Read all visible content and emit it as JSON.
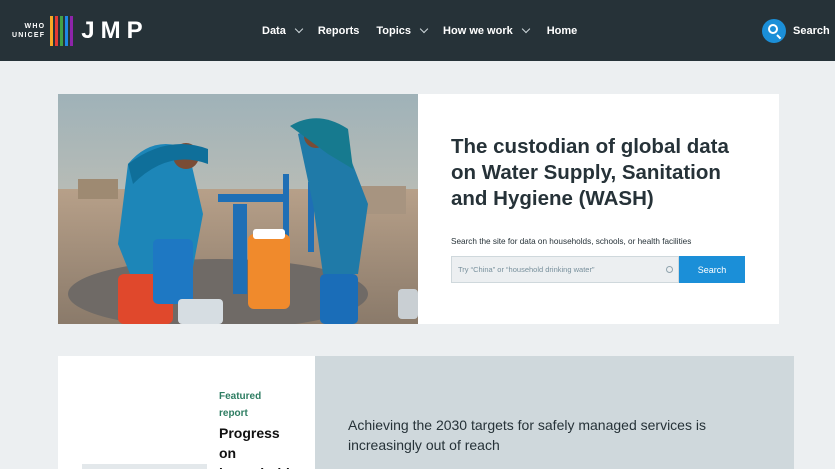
{
  "header": {
    "logo_small_top": "WHO",
    "logo_small_bottom": "UNICEF",
    "logo_text": "JMP",
    "logo_bar_colors": [
      "#f9a825",
      "#e53935",
      "#43a047",
      "#1e88e5",
      "#8e24aa"
    ],
    "nav": [
      {
        "label": "Data",
        "has_dropdown": true
      },
      {
        "label": "Reports",
        "has_dropdown": false
      },
      {
        "label": "Topics",
        "has_dropdown": true
      },
      {
        "label": "How we work",
        "has_dropdown": true
      },
      {
        "label": "Home",
        "has_dropdown": false
      }
    ],
    "search_label": "Search",
    "search_icon": "search-icon"
  },
  "hero": {
    "title": "The custodian of global data on Water Supply, Sanitation and Hygiene (WASH)",
    "subtitle": "Search the site for data on households, schools, or health facilities",
    "search_placeholder": "Try “China” or “household drinking water”",
    "search_button": "Search"
  },
  "featured": {
    "tag": "Featured report",
    "title": "Progress on household"
  },
  "targets": {
    "text": "Achieving the 2030 targets for safely managed services is increasingly out of reach"
  },
  "colors": {
    "header_bg": "#263238",
    "accent_blue": "#1b8fd8",
    "page_bg": "#eceff1",
    "panel_grey": "#cfd8dc",
    "featured_green": "#2e7d62"
  }
}
